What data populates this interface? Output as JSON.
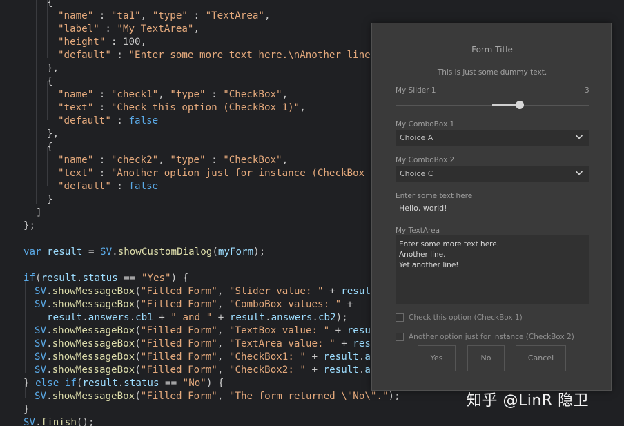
{
  "editor": {
    "lines": [
      [
        {
          "t": "{",
          "c": "p"
        }
      ],
      [
        {
          "t": "\"name\"",
          "c": "str"
        },
        {
          "t": " : ",
          "c": "p"
        },
        {
          "t": "\"ta1\"",
          "c": "str"
        },
        {
          "t": ", ",
          "c": "p"
        },
        {
          "t": "\"type\"",
          "c": "str"
        },
        {
          "t": " : ",
          "c": "p"
        },
        {
          "t": "\"TextArea\"",
          "c": "str"
        },
        {
          "t": ",",
          "c": "p"
        }
      ],
      [
        {
          "t": "\"label\"",
          "c": "str"
        },
        {
          "t": " : ",
          "c": "p"
        },
        {
          "t": "\"My TextArea\"",
          "c": "str"
        },
        {
          "t": ",",
          "c": "p"
        }
      ],
      [
        {
          "t": "\"height\"",
          "c": "str"
        },
        {
          "t": " : 100,",
          "c": "p"
        }
      ],
      [
        {
          "t": "\"default\"",
          "c": "str"
        },
        {
          "t": " : ",
          "c": "p"
        },
        {
          "t": "\"Enter some more text here.\\nAnother line.",
          "c": "str"
        }
      ],
      [
        {
          "t": "},",
          "c": "p"
        }
      ],
      [
        {
          "t": "{",
          "c": "p"
        }
      ],
      [
        {
          "t": "\"name\"",
          "c": "str"
        },
        {
          "t": " : ",
          "c": "p"
        },
        {
          "t": "\"check1\"",
          "c": "str"
        },
        {
          "t": ", ",
          "c": "p"
        },
        {
          "t": "\"type\"",
          "c": "str"
        },
        {
          "t": " : ",
          "c": "p"
        },
        {
          "t": "\"CheckBox\"",
          "c": "str"
        },
        {
          "t": ",",
          "c": "p"
        }
      ],
      [
        {
          "t": "\"text\"",
          "c": "str"
        },
        {
          "t": " : ",
          "c": "p"
        },
        {
          "t": "\"Check this option (CheckBox 1)\"",
          "c": "str"
        },
        {
          "t": ",",
          "c": "p"
        }
      ],
      [
        {
          "t": "\"default\"",
          "c": "str"
        },
        {
          "t": " : ",
          "c": "p"
        },
        {
          "t": "false",
          "c": "kw"
        }
      ],
      [
        {
          "t": "},",
          "c": "p"
        }
      ],
      [
        {
          "t": "{",
          "c": "p"
        }
      ],
      [
        {
          "t": "\"name\"",
          "c": "str"
        },
        {
          "t": " : ",
          "c": "p"
        },
        {
          "t": "\"check2\"",
          "c": "str"
        },
        {
          "t": ", ",
          "c": "p"
        },
        {
          "t": "\"type\"",
          "c": "str"
        },
        {
          "t": " : ",
          "c": "p"
        },
        {
          "t": "\"CheckBox\"",
          "c": "str"
        },
        {
          "t": ",",
          "c": "p"
        }
      ],
      [
        {
          "t": "\"text\"",
          "c": "str"
        },
        {
          "t": " : ",
          "c": "p"
        },
        {
          "t": "\"Another option just for instance (CheckBox 2",
          "c": "str"
        }
      ],
      [
        {
          "t": "\"default\"",
          "c": "str"
        },
        {
          "t": " : ",
          "c": "p"
        },
        {
          "t": "false",
          "c": "kw"
        }
      ],
      [
        {
          "t": "}",
          "c": "p"
        }
      ],
      [
        {
          "t": "]",
          "c": "p"
        }
      ],
      [
        {
          "t": "};",
          "c": "p"
        }
      ],
      [],
      [
        {
          "t": "var",
          "c": "kw"
        },
        {
          "t": " ",
          "c": "p"
        },
        {
          "t": "result",
          "c": "id"
        },
        {
          "t": " = ",
          "c": "p"
        },
        {
          "t": "SV",
          "c": "kw"
        },
        {
          "t": ".",
          "c": "p"
        },
        {
          "t": "showCustomDialog",
          "c": "fn"
        },
        {
          "t": "(",
          "c": "p"
        },
        {
          "t": "myForm",
          "c": "id"
        },
        {
          "t": ");",
          "c": "p"
        }
      ],
      [],
      [
        {
          "t": "if",
          "c": "kw"
        },
        {
          "t": "(",
          "c": "p"
        },
        {
          "t": "result",
          "c": "id"
        },
        {
          "t": ".",
          "c": "p"
        },
        {
          "t": "status",
          "c": "id"
        },
        {
          "t": " == ",
          "c": "p"
        },
        {
          "t": "\"Yes\"",
          "c": "str"
        },
        {
          "t": ") {",
          "c": "p"
        }
      ],
      [
        {
          "t": "SV",
          "c": "kw"
        },
        {
          "t": ".",
          "c": "p"
        },
        {
          "t": "showMessageBox",
          "c": "fn"
        },
        {
          "t": "(",
          "c": "p"
        },
        {
          "t": "\"Filled Form\"",
          "c": "str"
        },
        {
          "t": ", ",
          "c": "p"
        },
        {
          "t": "\"Slider value: \"",
          "c": "str"
        },
        {
          "t": " + ",
          "c": "p"
        },
        {
          "t": "result",
          "c": "id"
        }
      ],
      [
        {
          "t": "SV",
          "c": "kw"
        },
        {
          "t": ".",
          "c": "p"
        },
        {
          "t": "showMessageBox",
          "c": "fn"
        },
        {
          "t": "(",
          "c": "p"
        },
        {
          "t": "\"Filled Form\"",
          "c": "str"
        },
        {
          "t": ", ",
          "c": "p"
        },
        {
          "t": "\"ComboBox values: \"",
          "c": "str"
        },
        {
          "t": " +",
          "c": "p"
        }
      ],
      [
        {
          "t": "result",
          "c": "id"
        },
        {
          "t": ".",
          "c": "p"
        },
        {
          "t": "answers",
          "c": "id"
        },
        {
          "t": ".",
          "c": "p"
        },
        {
          "t": "cb1",
          "c": "id"
        },
        {
          "t": " + ",
          "c": "p"
        },
        {
          "t": "\" and \"",
          "c": "str"
        },
        {
          "t": " + ",
          "c": "p"
        },
        {
          "t": "result",
          "c": "id"
        },
        {
          "t": ".",
          "c": "p"
        },
        {
          "t": "answers",
          "c": "id"
        },
        {
          "t": ".",
          "c": "p"
        },
        {
          "t": "cb2",
          "c": "id"
        },
        {
          "t": ");",
          "c": "p"
        }
      ],
      [
        {
          "t": "SV",
          "c": "kw"
        },
        {
          "t": ".",
          "c": "p"
        },
        {
          "t": "showMessageBox",
          "c": "fn"
        },
        {
          "t": "(",
          "c": "p"
        },
        {
          "t": "\"Filled Form\"",
          "c": "str"
        },
        {
          "t": ", ",
          "c": "p"
        },
        {
          "t": "\"TextBox value: \"",
          "c": "str"
        },
        {
          "t": " + ",
          "c": "p"
        },
        {
          "t": "resul",
          "c": "id"
        }
      ],
      [
        {
          "t": "SV",
          "c": "kw"
        },
        {
          "t": ".",
          "c": "p"
        },
        {
          "t": "showMessageBox",
          "c": "fn"
        },
        {
          "t": "(",
          "c": "p"
        },
        {
          "t": "\"Filled Form\"",
          "c": "str"
        },
        {
          "t": ", ",
          "c": "p"
        },
        {
          "t": "\"TextArea value: \"",
          "c": "str"
        },
        {
          "t": " + ",
          "c": "p"
        },
        {
          "t": "resu",
          "c": "id"
        }
      ],
      [
        {
          "t": "SV",
          "c": "kw"
        },
        {
          "t": ".",
          "c": "p"
        },
        {
          "t": "showMessageBox",
          "c": "fn"
        },
        {
          "t": "(",
          "c": "p"
        },
        {
          "t": "\"Filled Form\"",
          "c": "str"
        },
        {
          "t": ", ",
          "c": "p"
        },
        {
          "t": "\"CheckBox1: \"",
          "c": "str"
        },
        {
          "t": " + ",
          "c": "p"
        },
        {
          "t": "result",
          "c": "id"
        },
        {
          "t": ".",
          "c": "p"
        },
        {
          "t": "an",
          "c": "id"
        }
      ],
      [
        {
          "t": "SV",
          "c": "kw"
        },
        {
          "t": ".",
          "c": "p"
        },
        {
          "t": "showMessageBox",
          "c": "fn"
        },
        {
          "t": "(",
          "c": "p"
        },
        {
          "t": "\"Filled Form\"",
          "c": "str"
        },
        {
          "t": ", ",
          "c": "p"
        },
        {
          "t": "\"CheckBox2: \"",
          "c": "str"
        },
        {
          "t": " + ",
          "c": "p"
        },
        {
          "t": "result",
          "c": "id"
        },
        {
          "t": ".",
          "c": "p"
        },
        {
          "t": "an",
          "c": "id"
        }
      ],
      [
        {
          "t": "} ",
          "c": "p"
        },
        {
          "t": "else",
          "c": "kw"
        },
        {
          "t": " ",
          "c": "p"
        },
        {
          "t": "if",
          "c": "kw"
        },
        {
          "t": "(",
          "c": "p"
        },
        {
          "t": "result",
          "c": "id"
        },
        {
          "t": ".",
          "c": "p"
        },
        {
          "t": "status",
          "c": "id"
        },
        {
          "t": " == ",
          "c": "p"
        },
        {
          "t": "\"No\"",
          "c": "str"
        },
        {
          "t": ") {",
          "c": "p"
        }
      ],
      [
        {
          "t": "SV",
          "c": "kw"
        },
        {
          "t": ".",
          "c": "p"
        },
        {
          "t": "showMessageBox",
          "c": "fn"
        },
        {
          "t": "(",
          "c": "p"
        },
        {
          "t": "\"Filled Form\"",
          "c": "str"
        },
        {
          "t": ", ",
          "c": "p"
        },
        {
          "t": "\"The form returned \\\"No\\\".\"",
          "c": "str"
        },
        {
          "t": ");",
          "c": "p"
        }
      ],
      [
        {
          "t": "}",
          "c": "p"
        }
      ],
      [
        {
          "t": "SV",
          "c": "kw"
        },
        {
          "t": ".",
          "c": "p"
        },
        {
          "t": "finish",
          "c": "fn"
        },
        {
          "t": "();",
          "c": "p"
        }
      ]
    ]
  },
  "dialog": {
    "title": "Form Title",
    "description": "This is just some dummy text.",
    "slider": {
      "label": "My Slider 1",
      "value": "3",
      "fraction": 0.65
    },
    "combo1": {
      "label": "My ComboBox 1",
      "selected": "Choice A"
    },
    "combo2": {
      "label": "My ComboBox 2",
      "selected": "Choice C"
    },
    "textbox": {
      "label": "Enter some text here",
      "value": "Hello, world!"
    },
    "textarea": {
      "label": "My TextArea",
      "lines": [
        "Enter some more text here.",
        "Another line.",
        "Yet another line!"
      ]
    },
    "check1": {
      "label": "Check this option (CheckBox 1)",
      "checked": false
    },
    "check2": {
      "label": "Another option just for instance (CheckBox 2)",
      "checked": false
    },
    "buttons": {
      "yes": "Yes",
      "no": "No",
      "cancel": "Cancel"
    }
  },
  "watermark": "知乎 @LinR 隐卫"
}
